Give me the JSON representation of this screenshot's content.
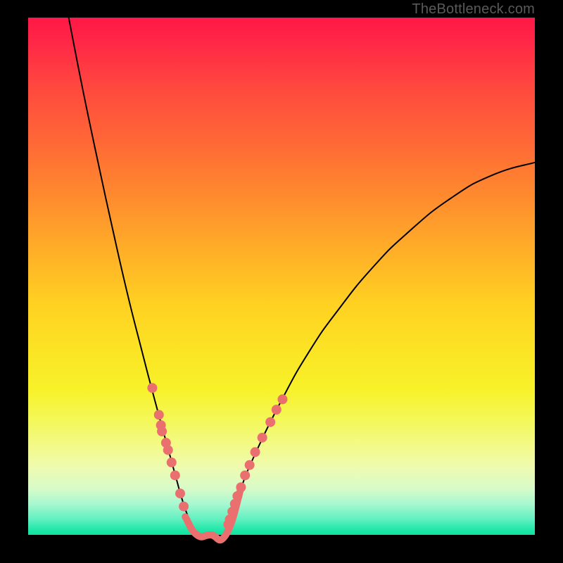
{
  "watermark": "TheBottleneck.com",
  "colors": {
    "page_bg": "#000000",
    "gradient_top": "#ff1846",
    "gradient_bottom": "#10e09e",
    "curve": "#000000",
    "marker": "#ea7070"
  },
  "chart_data": {
    "type": "line",
    "title": "",
    "xlabel": "",
    "ylabel": "",
    "xlim": [
      0,
      1
    ],
    "ylim": [
      0,
      1
    ],
    "series": [
      {
        "name": "left-curve",
        "x": [
          0.08,
          0.108,
          0.138,
          0.167,
          0.195,
          0.222,
          0.25,
          0.278,
          0.292,
          0.305,
          0.32,
          0.333
        ],
        "y": [
          1.0,
          0.86,
          0.72,
          0.59,
          0.47,
          0.365,
          0.26,
          0.16,
          0.11,
          0.065,
          0.025,
          0.0
        ]
      },
      {
        "name": "right-curve",
        "x": [
          0.39,
          0.402,
          0.42,
          0.445,
          0.5,
          0.555,
          0.612,
          0.68,
          0.75,
          0.833,
          0.915,
          1.0
        ],
        "y": [
          0.0,
          0.04,
          0.09,
          0.15,
          0.26,
          0.355,
          0.435,
          0.517,
          0.585,
          0.65,
          0.695,
          0.72
        ]
      },
      {
        "name": "trough",
        "x": [
          0.31,
          0.333,
          0.36,
          0.39,
          0.42
        ],
        "y": [
          0.035,
          0.0,
          0.0,
          0.0,
          0.09
        ]
      }
    ],
    "markers": {
      "left_dots": [
        {
          "x": 0.245,
          "y": 0.284
        },
        {
          "x": 0.258,
          "y": 0.232
        },
        {
          "x": 0.262,
          "y": 0.212
        },
        {
          "x": 0.264,
          "y": 0.2
        },
        {
          "x": 0.272,
          "y": 0.178
        },
        {
          "x": 0.276,
          "y": 0.164
        },
        {
          "x": 0.283,
          "y": 0.14
        },
        {
          "x": 0.29,
          "y": 0.115
        },
        {
          "x": 0.3,
          "y": 0.08
        },
        {
          "x": 0.307,
          "y": 0.055
        }
      ],
      "right_dots": [
        {
          "x": 0.395,
          "y": 0.02
        },
        {
          "x": 0.398,
          "y": 0.03
        },
        {
          "x": 0.403,
          "y": 0.045
        },
        {
          "x": 0.408,
          "y": 0.06
        },
        {
          "x": 0.413,
          "y": 0.075
        },
        {
          "x": 0.42,
          "y": 0.092
        },
        {
          "x": 0.428,
          "y": 0.115
        },
        {
          "x": 0.437,
          "y": 0.135
        },
        {
          "x": 0.448,
          "y": 0.16
        },
        {
          "x": 0.462,
          "y": 0.188
        },
        {
          "x": 0.478,
          "y": 0.218
        },
        {
          "x": 0.49,
          "y": 0.242
        },
        {
          "x": 0.502,
          "y": 0.262
        }
      ]
    }
  }
}
